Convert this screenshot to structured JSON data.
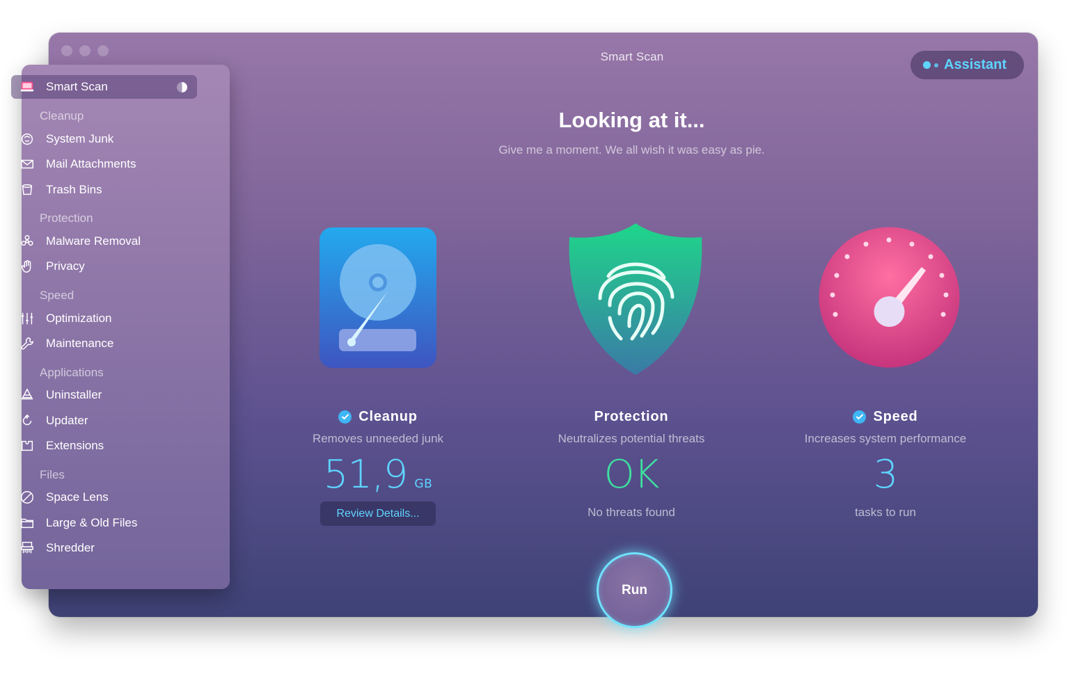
{
  "window": {
    "title": "Smart Scan"
  },
  "assistant": {
    "label": "Assistant",
    "accent": "#5fd4ff"
  },
  "sidebar": {
    "active": {
      "label": "Smart Scan",
      "icon": "monitor-icon"
    },
    "sections": [
      {
        "title": "Cleanup",
        "items": [
          {
            "label": "System Junk",
            "icon": "junk-icon"
          },
          {
            "label": "Mail Attachments",
            "icon": "mail-icon"
          },
          {
            "label": "Trash Bins",
            "icon": "trash-icon"
          }
        ]
      },
      {
        "title": "Protection",
        "items": [
          {
            "label": "Malware Removal",
            "icon": "biohazard-icon"
          },
          {
            "label": "Privacy",
            "icon": "hand-icon"
          }
        ]
      },
      {
        "title": "Speed",
        "items": [
          {
            "label": "Optimization",
            "icon": "sliders-icon"
          },
          {
            "label": "Maintenance",
            "icon": "wrench-icon"
          }
        ]
      },
      {
        "title": "Applications",
        "items": [
          {
            "label": "Uninstaller",
            "icon": "uninstaller-icon"
          },
          {
            "label": "Updater",
            "icon": "updater-icon"
          },
          {
            "label": "Extensions",
            "icon": "extensions-icon"
          }
        ]
      },
      {
        "title": "Files",
        "items": [
          {
            "label": "Space Lens",
            "icon": "space-lens-icon"
          },
          {
            "label": "Large & Old Files",
            "icon": "folder-icon"
          },
          {
            "label": "Shredder",
            "icon": "shredder-icon"
          }
        ]
      }
    ]
  },
  "main": {
    "headline": "Looking at it...",
    "subline": "Give me a moment. We all wish it was easy as pie.",
    "cards": {
      "cleanup": {
        "title": "Cleanup",
        "checked": true,
        "description": "Removes unneeded junk",
        "value": "51,9",
        "unit": "GB",
        "button": "Review Details...",
        "value_color": "#5fd4ff"
      },
      "protection": {
        "title": "Protection",
        "checked": false,
        "description": "Neutralizes potential threats",
        "value": "OK",
        "footer": "No threats found",
        "value_color": "#3ee0a0"
      },
      "speed": {
        "title": "Speed",
        "checked": true,
        "description": "Increases system performance",
        "value": "3",
        "footer": "tasks to run",
        "value_color": "#5fd4ff"
      }
    },
    "run_button": "Run"
  }
}
